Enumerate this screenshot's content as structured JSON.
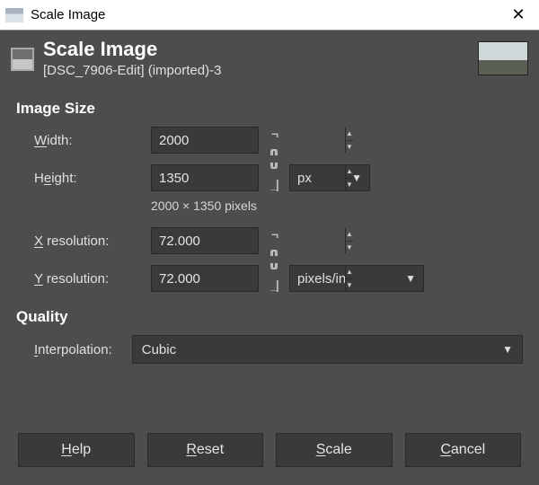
{
  "window": {
    "title": "Scale Image"
  },
  "header": {
    "title": "Scale Image",
    "subtitle": "[DSC_7906-Edit] (imported)-3"
  },
  "sections": {
    "image_size_title": "Image Size",
    "quality_title": "Quality"
  },
  "fields": {
    "width_label_pre": "W",
    "width_label_post": "idth:",
    "width_value": "2000",
    "height_label_pre": "H",
    "height_label_mn": "e",
    "height_label_post": "ight:",
    "height_value": "1350",
    "size_unit": "px",
    "size_note": "2000 × 1350 pixels",
    "xres_label_mn": "X",
    "xres_label_post": " resolution:",
    "xres_value": "72.000",
    "yres_label_mn": "Y",
    "yres_label_post": " resolution:",
    "yres_value": "72.000",
    "res_unit": "pixels/in",
    "interp_label_mn": "I",
    "interp_label_post": "nterpolation:",
    "interp_value": "Cubic"
  },
  "buttons": {
    "help_mn": "H",
    "help_post": "elp",
    "reset_mn": "R",
    "reset_post": "eset",
    "scale_mn": "S",
    "scale_post": "cale",
    "cancel_mn": "C",
    "cancel_post": "ancel"
  }
}
